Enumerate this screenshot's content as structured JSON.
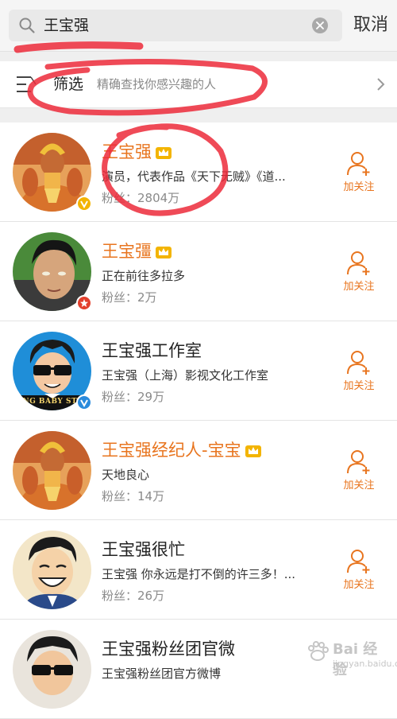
{
  "search": {
    "query": "王宝强",
    "cancel_label": "取消"
  },
  "filter": {
    "label": "筛选",
    "description": "精确查找你感兴趣的人"
  },
  "colors": {
    "accent": "#e8751f",
    "badge_gold": "#f3b400",
    "badge_red": "#e2402d",
    "badge_blue": "#2a8bdc"
  },
  "users": [
    {
      "name": "王宝强",
      "name_style": "orange",
      "crown": true,
      "description": "演员，代表作品《天下无贼》《道...",
      "fans": "粉丝：2804万",
      "follow_label": "加关注",
      "badge": "gold-v",
      "avatar": "hanuman"
    },
    {
      "name": "王宝彊",
      "name_style": "orange",
      "crown": true,
      "description": "正在前往多拉多",
      "fans": "粉丝：2万",
      "follow_label": "加关注",
      "badge": "red-star",
      "avatar": "man-portrait"
    },
    {
      "name": "王宝强工作室",
      "name_style": "black",
      "crown": false,
      "description": "王宝强（上海）影视文化工作室",
      "fans": "粉丝：29万",
      "follow_label": "加关注",
      "badge": "blue-v",
      "avatar": "cartoon-sunglasses",
      "avatar_text": "ONG BABY STU"
    },
    {
      "name": "王宝强经纪人-宝宝",
      "name_style": "orange",
      "crown": true,
      "description": "天地良心",
      "fans": "粉丝：14万",
      "follow_label": "加关注",
      "badge": "",
      "avatar": "hanuman"
    },
    {
      "name": "王宝强很忙",
      "name_style": "black",
      "crown": false,
      "description": "王宝强 你永远是打不倒的许三多！...",
      "fans": "粉丝：26万",
      "follow_label": "加关注",
      "badge": "",
      "avatar": "cartoon-laughing"
    },
    {
      "name": "王宝强粉丝团官微",
      "name_style": "black",
      "crown": false,
      "description": "王宝强粉丝团官方微博",
      "fans": "",
      "follow_label": "",
      "badge": "",
      "avatar": "cartoon-sunglasses-2"
    }
  ],
  "watermark": {
    "text": "Bai 经验",
    "url": "jingyan.baidu.com"
  }
}
